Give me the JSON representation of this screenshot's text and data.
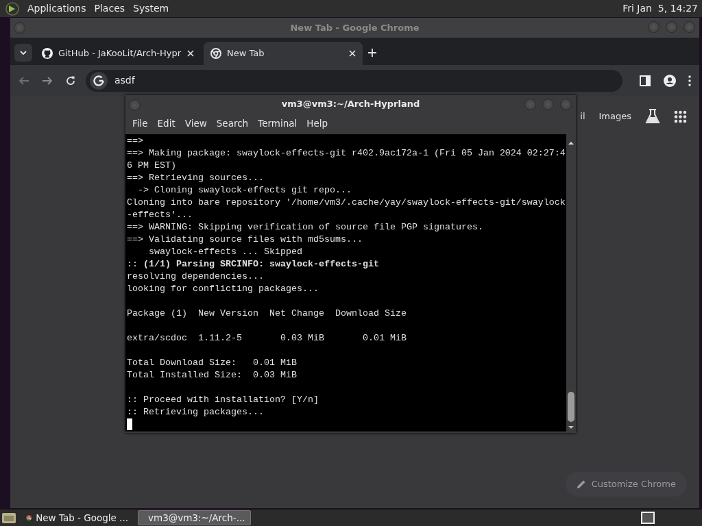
{
  "top_panel": {
    "menus": [
      "Applications",
      "Places",
      "System"
    ],
    "clock": "Fri Jan  5, 14:27"
  },
  "chrome": {
    "title": "New Tab - Google Chrome",
    "tabs": [
      {
        "label": "GitHub - JaKooLit/Arch-Hypr",
        "selected": false,
        "kind": "github"
      },
      {
        "label": "New Tab",
        "selected": true,
        "kind": "chrome"
      }
    ],
    "address": "asdf",
    "page_links": [
      "il",
      "Images"
    ],
    "customize_button": "Customize Chrome"
  },
  "terminal": {
    "title": "vm3@vm3:~/Arch-Hyprland",
    "menus": [
      "File",
      "Edit",
      "View",
      "Search",
      "Terminal",
      "Help"
    ],
    "blocks": [
      [
        "==>",
        "==> Making package: swaylock-effects-git r402.9ac172a-1 (Fri 05 Jan 2024 02:27:4",
        "6 PM EST)",
        "==> Retrieving sources...",
        "  -> Cloning swaylock-effects git repo...",
        "Cloning into bare repository '/home/vm3/.cache/yay/swaylock-effects-git/swaylock",
        "-effects'...",
        "==> WARNING: Skipping verification of source file PGP signatures.",
        "==> Validating source files with md5sums...",
        "    swaylock-effects ... Skipped",
        ":: **(1/1) Parsing SRCINFO: swaylock-effects-git**",
        "resolving dependencies...",
        "looking for conflicting packages..."
      ],
      [
        "Package (1)  New Version  Net Change  Download Size"
      ],
      [
        "extra/scdoc  1.11.2-5       0.03 MiB       0.01 MiB"
      ],
      [
        "Total Download Size:   0.01 MiB",
        "Total Installed Size:  0.03 MiB"
      ],
      [
        ":: Proceed with installation? [Y/n]",
        ":: Retrieving packages..."
      ]
    ]
  },
  "taskbar": {
    "items": [
      {
        "label": "New Tab - Google ...",
        "selected": false,
        "kind": "chrome"
      },
      {
        "label": "vm3@vm3:~/Arch-...",
        "selected": true,
        "kind": "terminal"
      }
    ]
  }
}
